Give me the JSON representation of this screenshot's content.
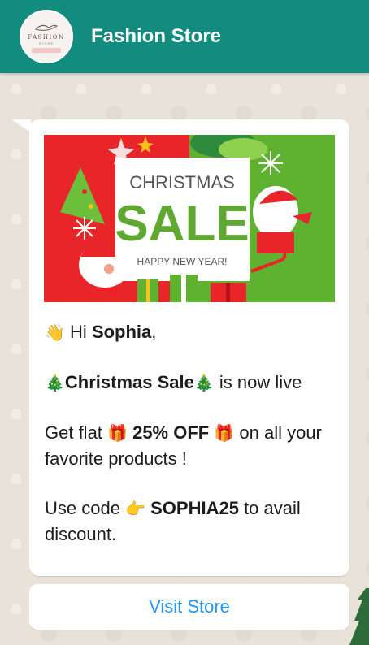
{
  "header": {
    "store_name": "Fashion Store",
    "avatar_logo_text": "FASHION",
    "avatar_logo_sub": "STORE"
  },
  "banner": {
    "line1": "CHRISTMAS",
    "line2": "SALE",
    "line3": "HAPPY NEW YEAR!"
  },
  "message": {
    "wave_icon": "waving-hand-icon",
    "greeting_prefix": "Hi",
    "customer_name": "Sophia",
    "greeting_suffix": ",",
    "tree_icon": "christmas-tree-icon",
    "sale_name": "Christmas Sale",
    "sale_suffix": "is now live",
    "offer_prefix": "Get flat",
    "gift_icon": "gift-icon",
    "discount": "25% OFF",
    "offer_suffix": "on all your favorite products !",
    "code_prefix": "Use code",
    "point_icon": "pointing-hand-icon",
    "code": "SOPHIA25",
    "code_suffix": "to avail discount."
  },
  "button": {
    "visit_store_label": "Visit Store"
  },
  "colors": {
    "header": "#128c7e",
    "link": "#2196f3",
    "banner_red": "#e8262a",
    "banner_green": "#5fb130"
  }
}
